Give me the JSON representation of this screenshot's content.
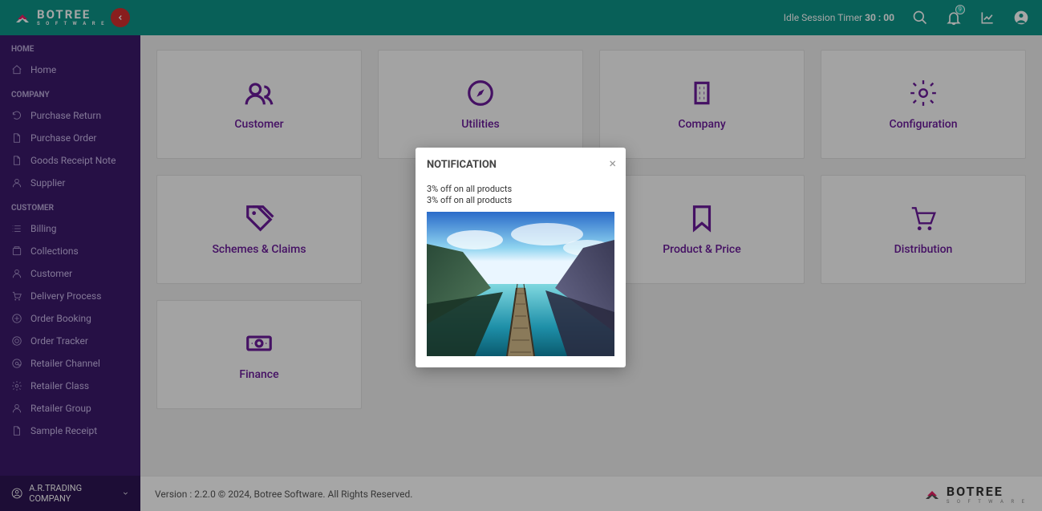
{
  "header": {
    "brand_top": "BOTREE",
    "brand_sub": "S O F T W A R E",
    "idle_prefix": "Idle Session Timer ",
    "idle_value": "30 : 00",
    "notif_count": "9"
  },
  "sidebar": {
    "sections": [
      {
        "title": "HOME",
        "items": [
          {
            "icon": "home",
            "label": "Home"
          }
        ]
      },
      {
        "title": "COMPANY",
        "items": [
          {
            "icon": "refresh",
            "label": "Purchase Return"
          },
          {
            "icon": "file",
            "label": "Purchase Order"
          },
          {
            "icon": "file",
            "label": "Goods Receipt Note"
          },
          {
            "icon": "person",
            "label": "Supplier"
          }
        ]
      },
      {
        "title": "CUSTOMER",
        "items": [
          {
            "icon": "list",
            "label": "Billing"
          },
          {
            "icon": "collections",
            "label": "Collections"
          },
          {
            "icon": "person",
            "label": "Customer"
          },
          {
            "icon": "cart",
            "label": "Delivery Process"
          },
          {
            "icon": "plus-circle",
            "label": "Order Booking"
          },
          {
            "icon": "target",
            "label": "Order Tracker"
          },
          {
            "icon": "at",
            "label": "Retailer Channel"
          },
          {
            "icon": "gear",
            "label": "Retailer Class"
          },
          {
            "icon": "person",
            "label": "Retailer Group"
          },
          {
            "icon": "file",
            "label": "Sample Receipt"
          }
        ]
      }
    ],
    "footer_company": "A.R.TRADING COMPANY"
  },
  "cards": [
    {
      "icon": "users",
      "label": "Customer"
    },
    {
      "icon": "compass",
      "label": "Utilities"
    },
    {
      "icon": "building",
      "label": "Company"
    },
    {
      "icon": "gear",
      "label": "Configuration"
    },
    {
      "icon": "tag",
      "label": "Schemes & Claims"
    },
    {
      "icon": "blank",
      "label": ""
    },
    {
      "icon": "bookmark",
      "label": "Product & Price"
    },
    {
      "icon": "cart",
      "label": "Distribution"
    },
    {
      "icon": "cash",
      "label": "Finance"
    }
  ],
  "footer": {
    "version_text": "Version : 2.2.0 © 2024, Botree Software. All Rights Reserved.",
    "brand_top": "BOTREE",
    "brand_sub": "S O F T W A R E"
  },
  "modal": {
    "title": "NOTIFICATION",
    "lines": [
      "3% off on all products",
      "3% off on all products"
    ]
  }
}
